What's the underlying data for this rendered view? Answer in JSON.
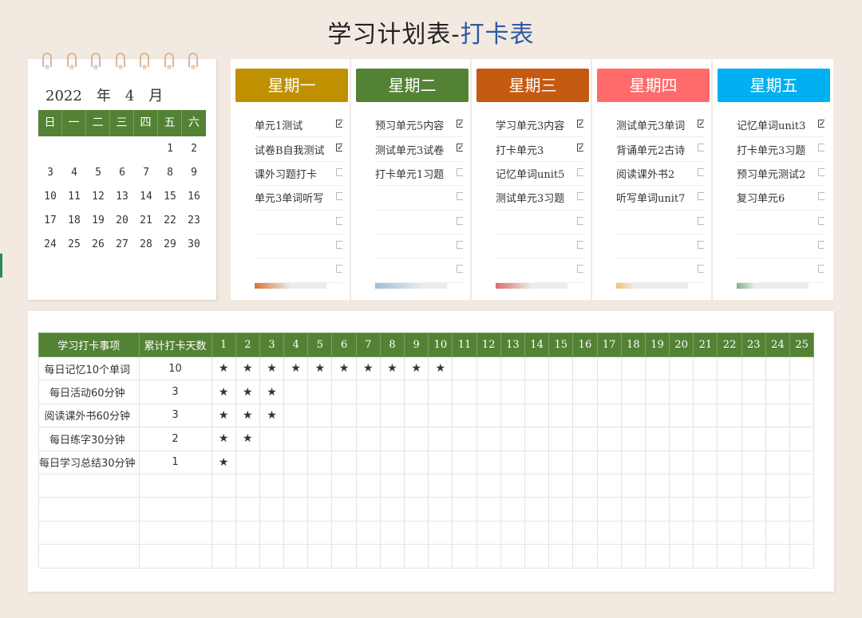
{
  "title": {
    "main": "学习计划表-",
    "accent": "打卡表"
  },
  "calendar": {
    "year": "2022",
    "year_unit": "年",
    "month": "4",
    "month_unit": "月",
    "weekday_headers": [
      "日",
      "一",
      "二",
      "三",
      "四",
      "五",
      "六"
    ],
    "weeks": [
      [
        "",
        "",
        "",
        "",
        "",
        "1",
        "2"
      ],
      [
        "3",
        "4",
        "5",
        "6",
        "7",
        "8",
        "9"
      ],
      [
        "10",
        "11",
        "12",
        "13",
        "14",
        "15",
        "16"
      ],
      [
        "17",
        "18",
        "19",
        "20",
        "21",
        "22",
        "23"
      ],
      [
        "24",
        "25",
        "26",
        "27",
        "28",
        "29",
        "30"
      ]
    ]
  },
  "days": [
    {
      "label": "星期一",
      "color": "#bf9000",
      "progress": 0.5,
      "bar_color": "#d9733a",
      "tasks": [
        {
          "text": "单元1测试",
          "checked": true
        },
        {
          "text": "试卷B自我测试",
          "checked": true
        },
        {
          "text": "课外习题打卡",
          "checked": false
        },
        {
          "text": "单元3单词听写",
          "checked": false
        },
        {
          "text": "",
          "checked": false
        },
        {
          "text": "",
          "checked": false
        },
        {
          "text": "",
          "checked": false
        }
      ]
    },
    {
      "label": "星期二",
      "color": "#548235",
      "progress": 0.67,
      "bar_color": "#9fbfd6",
      "tasks": [
        {
          "text": "预习单元5内容",
          "checked": true
        },
        {
          "text": "测试单元3试卷",
          "checked": true
        },
        {
          "text": "打卡单元1习题",
          "checked": false
        },
        {
          "text": "",
          "checked": false
        },
        {
          "text": "",
          "checked": false
        },
        {
          "text": "",
          "checked": false
        },
        {
          "text": "",
          "checked": false
        }
      ]
    },
    {
      "label": "星期三",
      "color": "#c55a11",
      "progress": 0.5,
      "bar_color": "#e06a6a",
      "tasks": [
        {
          "text": "学习单元3内容",
          "checked": true
        },
        {
          "text": "打卡单元3",
          "checked": true
        },
        {
          "text": "记忆单词unit5",
          "checked": false
        },
        {
          "text": "测试单元3习题",
          "checked": false
        },
        {
          "text": "",
          "checked": false
        },
        {
          "text": "",
          "checked": false
        },
        {
          "text": "",
          "checked": false
        }
      ]
    },
    {
      "label": "星期四",
      "color": "#ff6b6b",
      "progress": 0.25,
      "bar_color": "#f2c46d",
      "tasks": [
        {
          "text": "测试单元3单词",
          "checked": true
        },
        {
          "text": "背诵单元2古诗",
          "checked": false
        },
        {
          "text": "阅读课外书2",
          "checked": false
        },
        {
          "text": "听写单词unit7",
          "checked": false
        },
        {
          "text": "",
          "checked": false
        },
        {
          "text": "",
          "checked": false
        },
        {
          "text": "",
          "checked": false
        }
      ]
    },
    {
      "label": "星期五",
      "color": "#00b0f0",
      "progress": 0.25,
      "bar_color": "#7fae8a",
      "tasks": [
        {
          "text": "记忆单词unit3",
          "checked": true
        },
        {
          "text": "打卡单元3习题",
          "checked": false
        },
        {
          "text": "预习单元测试2",
          "checked": false
        },
        {
          "text": "复习单元6",
          "checked": false
        },
        {
          "text": "",
          "checked": false
        },
        {
          "text": "",
          "checked": false
        },
        {
          "text": "",
          "checked": false
        }
      ]
    }
  ],
  "tracker": {
    "col_item": "学习打卡事项",
    "col_total": "累计打卡天数",
    "day_numbers": [
      "1",
      "2",
      "3",
      "4",
      "5",
      "6",
      "7",
      "8",
      "9",
      "10",
      "11",
      "12",
      "13",
      "14",
      "15",
      "16",
      "17",
      "18",
      "19",
      "20",
      "21",
      "22",
      "23",
      "24",
      "25"
    ],
    "star_glyph": "★",
    "rows": [
      {
        "name": "每日记忆10个单词",
        "total": "10",
        "stars": 10
      },
      {
        "name": "每日活动60分钟",
        "total": "3",
        "stars": 3
      },
      {
        "name": "阅读课外书60分钟",
        "total": "3",
        "stars": 3
      },
      {
        "name": "每日练字30分钟",
        "total": "2",
        "stars": 2
      },
      {
        "name": "每日学习总结30分钟",
        "total": "1",
        "stars": 1
      },
      {
        "name": "",
        "total": "",
        "stars": 0
      },
      {
        "name": "",
        "total": "",
        "stars": 0
      },
      {
        "name": "",
        "total": "",
        "stars": 0
      },
      {
        "name": "",
        "total": "",
        "stars": 0
      }
    ]
  }
}
